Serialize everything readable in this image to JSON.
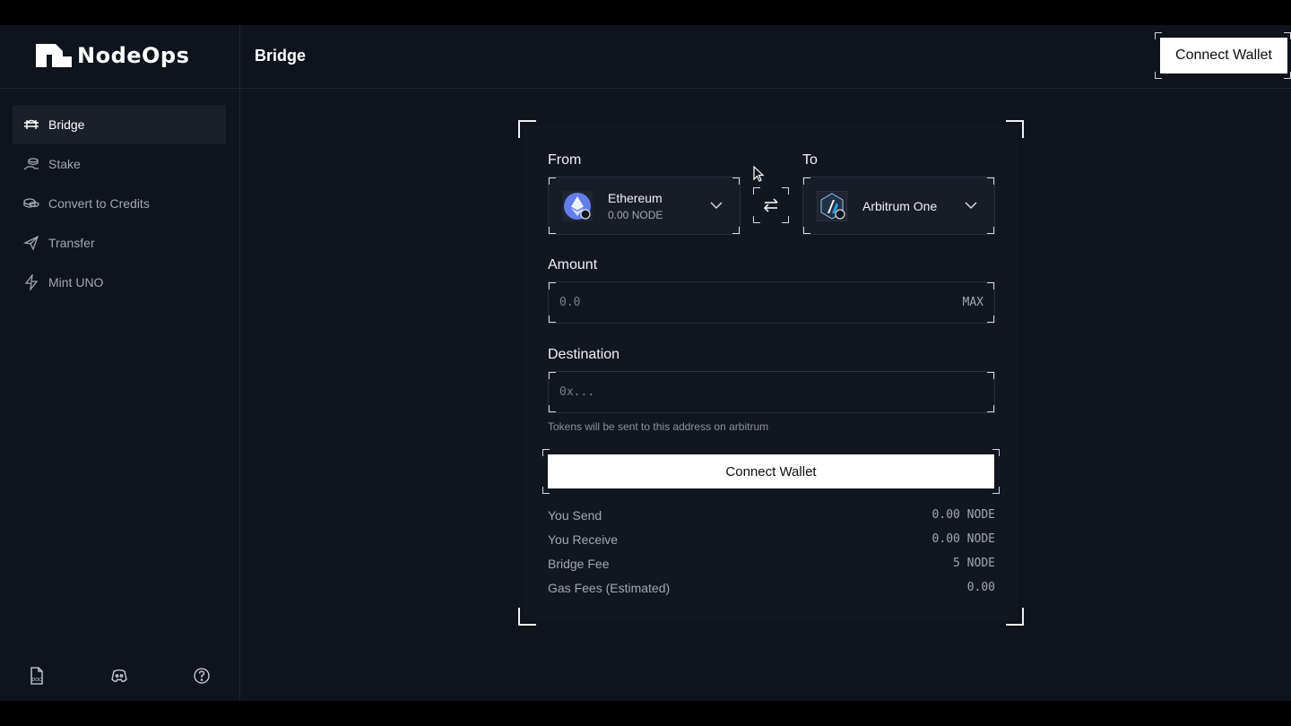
{
  "brand": {
    "name": "NodeOps"
  },
  "header": {
    "title": "Bridge",
    "connect_label": "Connect Wallet"
  },
  "sidebar": {
    "items": [
      {
        "label": "Bridge",
        "icon": "bridge-icon",
        "active": true
      },
      {
        "label": "Stake",
        "icon": "stake-icon",
        "active": false
      },
      {
        "label": "Convert to Credits",
        "icon": "coins-icon",
        "active": false
      },
      {
        "label": "Transfer",
        "icon": "send-icon",
        "active": false
      },
      {
        "label": "Mint UNO",
        "icon": "lightning-icon",
        "active": false
      }
    ],
    "footer": [
      {
        "icon": "doc-icon"
      },
      {
        "icon": "discord-icon"
      },
      {
        "icon": "help-icon"
      }
    ]
  },
  "bridge": {
    "from_label": "From",
    "to_label": "To",
    "from_chain": {
      "name": "Ethereum",
      "balance": "0.00 NODE",
      "icon": "ethereum-icon"
    },
    "to_chain": {
      "name": "Arbitrum One",
      "icon": "arbitrum-icon"
    },
    "amount_label": "Amount",
    "amount_placeholder": "0.0",
    "max_label": "MAX",
    "destination_label": "Destination",
    "destination_placeholder": "0x...",
    "destination_hint": "Tokens will be sent to this address on arbitrum",
    "connect_label": "Connect Wallet",
    "summary": [
      {
        "label": "You Send",
        "value": "0.00 NODE"
      },
      {
        "label": "You Receive",
        "value": "0.00 NODE"
      },
      {
        "label": "Bridge Fee",
        "value": "5 NODE"
      },
      {
        "label": "Gas Fees (Estimated)",
        "value": "0.00"
      }
    ]
  },
  "colors": {
    "background": "#0f131c",
    "card": "#12161f",
    "accent": "#ffffff",
    "ethereum": "#627eea",
    "arbitrum": "#28a0f0"
  }
}
